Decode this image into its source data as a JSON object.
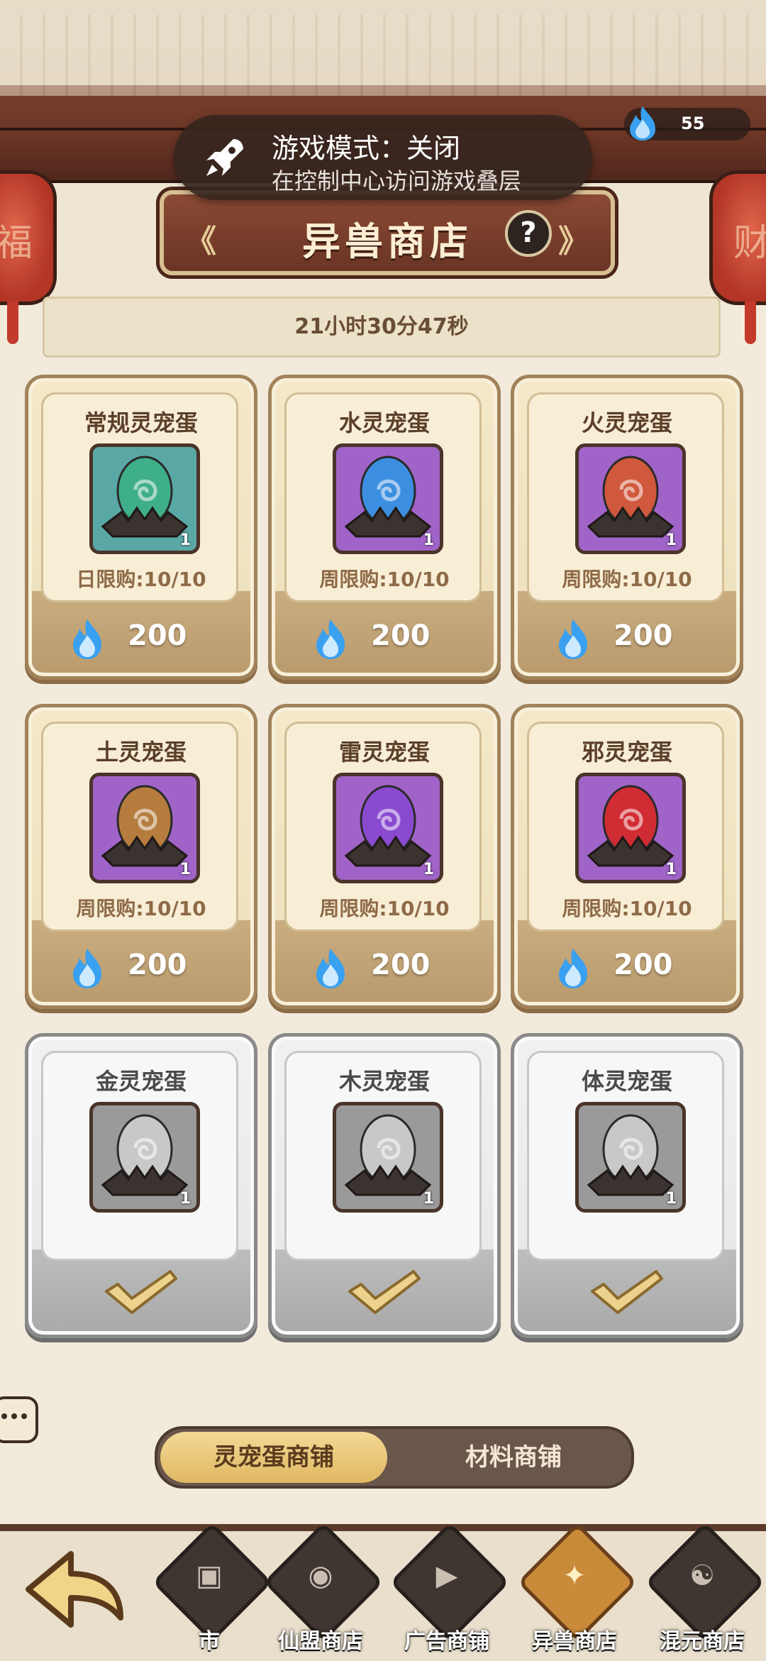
{
  "status": {
    "game_mode_title": "游戏模式：关闭",
    "game_mode_subtitle": "在控制中心访问游戏叠层"
  },
  "currency": {
    "icon": "blue-flame-icon",
    "amount": "55"
  },
  "header": {
    "title": "异兽商店",
    "help_label": "?"
  },
  "timer": "21小时30分47秒",
  "colors": {
    "accent_gold": "#e0b862",
    "flame_blue": "#3aa0f0",
    "banner_brown": "#7a3f2c"
  },
  "shop_items": [
    {
      "name": "常规灵宠蛋",
      "egg_color": "#3fae8a",
      "slot": "teal",
      "qty": "1",
      "limit": "日限购:10/10",
      "price": "200",
      "sold_out": false
    },
    {
      "name": "水灵宠蛋",
      "egg_color": "#3c8fe0",
      "slot": "purple",
      "qty": "1",
      "limit": "周限购:10/10",
      "price": "200",
      "sold_out": false
    },
    {
      "name": "火灵宠蛋",
      "egg_color": "#d0583c",
      "slot": "purple",
      "qty": "1",
      "limit": "周限购:10/10",
      "price": "200",
      "sold_out": false
    },
    {
      "name": "土灵宠蛋",
      "egg_color": "#b57c3e",
      "slot": "purple",
      "qty": "1",
      "limit": "周限购:10/10",
      "price": "200",
      "sold_out": false
    },
    {
      "name": "雷灵宠蛋",
      "egg_color": "#8a4ad0",
      "slot": "purple",
      "qty": "1",
      "limit": "周限购:10/10",
      "price": "200",
      "sold_out": false
    },
    {
      "name": "邪灵宠蛋",
      "egg_color": "#d02c34",
      "slot": "purple",
      "qty": "1",
      "limit": "周限购:10/10",
      "price": "200",
      "sold_out": false
    },
    {
      "name": "金灵宠蛋",
      "egg_color": "#c8c8c8",
      "slot": "gray",
      "qty": "1",
      "limit": "",
      "price": "",
      "sold_out": true
    },
    {
      "name": "木灵宠蛋",
      "egg_color": "#c8c8c8",
      "slot": "gray",
      "qty": "1",
      "limit": "",
      "price": "",
      "sold_out": true
    },
    {
      "name": "体灵宠蛋",
      "egg_color": "#c8c8c8",
      "slot": "gray",
      "qty": "1",
      "limit": "",
      "price": "",
      "sold_out": true
    }
  ],
  "tabs": [
    {
      "label": "灵宠蛋商铺",
      "active": true
    },
    {
      "label": "材料商铺",
      "active": false
    }
  ],
  "bottom_nav": [
    {
      "label": "市",
      "icon": "market-icon",
      "active": false
    },
    {
      "label": "仙盟商店",
      "icon": "alliance-shop-icon",
      "active": false
    },
    {
      "label": "广告商铺",
      "icon": "video-ad-icon",
      "active": false
    },
    {
      "label": "异兽商店",
      "icon": "beast-shop-icon",
      "active": true
    },
    {
      "label": "混元商店",
      "icon": "hunyuan-shop-icon",
      "active": false
    }
  ]
}
